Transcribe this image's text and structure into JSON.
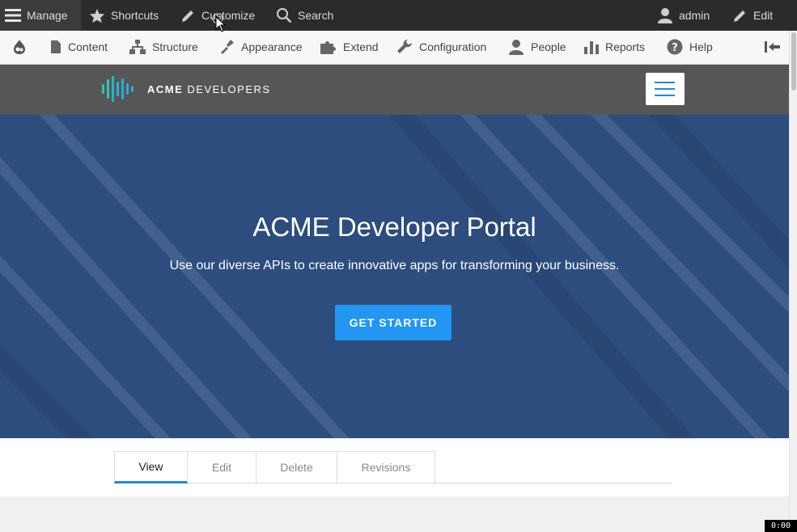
{
  "admin_toolbar": {
    "manage": "Manage",
    "shortcuts": "Shortcuts",
    "customize": "Customize",
    "search": "Search",
    "user": "admin",
    "edit": "Edit"
  },
  "admin_menu": {
    "items": [
      "Content",
      "Structure",
      "Appearance",
      "Extend",
      "Configuration",
      "People",
      "Reports",
      "Help"
    ]
  },
  "site": {
    "logo_bold": "ACME",
    "logo_rest": "DEVELOPERS"
  },
  "hero": {
    "title": "ACME Developer Portal",
    "subtitle": "Use our diverse APIs to create innovative apps for transforming your business.",
    "button": "GET STARTED"
  },
  "tabs": [
    "View",
    "Edit",
    "Delete",
    "Revisions"
  ],
  "recording_timer": "0:00",
  "colors": {
    "toolbar_dark": "#2b2b2b",
    "accent": "#2196f3",
    "hero_bg": "#2c4d7d"
  }
}
